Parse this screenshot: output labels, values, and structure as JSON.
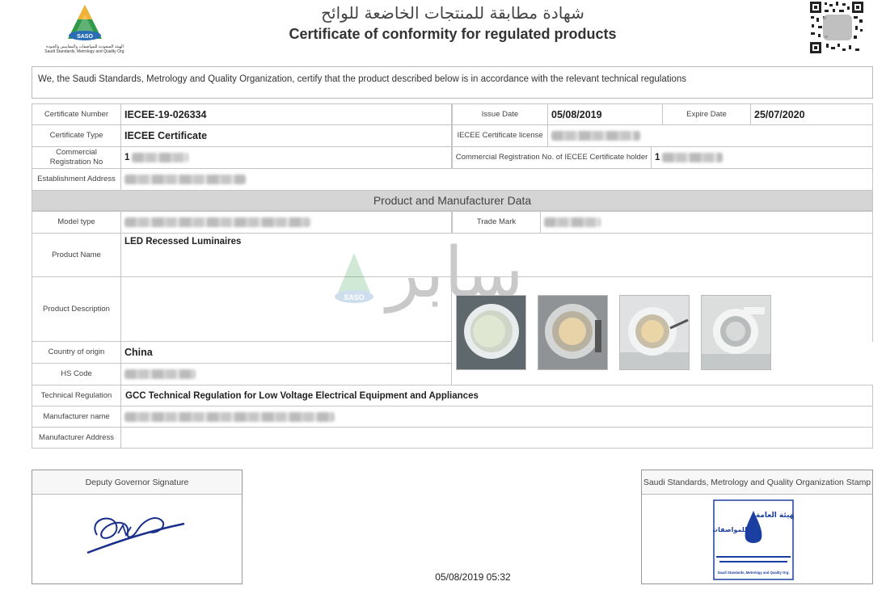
{
  "header": {
    "logo_text": "SASO",
    "logo_caption_ar": "الهيئة السعودية للمواصفات والمقاييس والجودة",
    "logo_caption_en": "Saudi Standards, Metrology and Quality Org.",
    "title_ar": "شهادة مطابقة للمنتجات الخاضعة للوائح",
    "title_en": "Certificate of conformity for regulated products"
  },
  "intro": "We, the Saudi Standards, Metrology and Quality Organization, certify that the product described below is in accordance with the relevant technical regulations",
  "certificate": {
    "number_label": "Certificate Number",
    "number": "IECEE-19-026334",
    "issue_label": "Issue Date",
    "issue_date": "05/08/2019",
    "expire_label": "Expire Date",
    "expire_date": "25/07/2020",
    "type_label": "Certificate Type",
    "type": "IECEE Certificate",
    "license_label": "IECEE Certificate license",
    "cr_label": "Commercial Registration No",
    "cr_prefix": "1",
    "cr_holder_label": "Commercial Registration No. of IECEE Certificate holder",
    "cr_holder_prefix": "1",
    "establishment_label": "Establishment Address"
  },
  "product": {
    "section_title": "Product and Manufacturer Data",
    "model_label": "Model type",
    "trademark_label": "Trade Mark",
    "name_label": "Product Name",
    "name": "LED Recessed Luminaires",
    "description_label": "Product Description",
    "origin_label": "Country of origin",
    "origin": "China",
    "hs_label": "HS Code",
    "regulation_label": "Technical Regulation",
    "regulation": "GCC Technical Regulation for Low Voltage Electrical Equipment and Appliances",
    "manufacturer_label": "Manufacturer name",
    "manufacturer_address_label": "Manufacturer Address"
  },
  "watermark": {
    "text": "سابر",
    "logo_text": "SASO"
  },
  "signature": {
    "deputy_label": "Deputy Governor Signature",
    "stamp_label": "Saudi Standards, Metrology and Quality Organization Stamp",
    "stamp_text_ar_1": "الهيئة العامة",
    "stamp_text_ar_2": "للمواصفات",
    "stamp_text_en": "Saudi Standards, Metrology and Quality Org."
  },
  "footer": {
    "datetime": "05/08/2019 05:32"
  },
  "colors": {
    "saso_green": "#2e9a4a",
    "saso_blue": "#2a6db5",
    "stamp_blue": "#1b3fa0",
    "signature_blue": "#1a2e8c",
    "section_gray": "#d5d5d5"
  }
}
